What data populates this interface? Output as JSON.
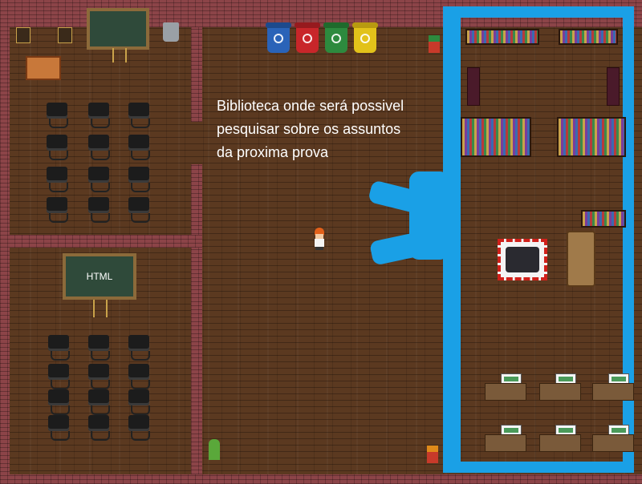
{
  "map": {
    "room_note": "Biblioteca onde será possivel pesquisar sobre os assuntos da proxima prova",
    "board_html_label": "HTML"
  },
  "colors": {
    "floor": "#5b3920",
    "wall": "#8c4448",
    "highlight": "#1aa0e6",
    "bin_blue": "#2a63b8",
    "bin_red": "#c8262a",
    "bin_green": "#2d8a3e",
    "bin_yellow": "#e2c21a"
  },
  "icons": [
    "recycle-bin-icon",
    "chair-icon",
    "bookshelf-icon",
    "computer-desk-icon",
    "cactus-icon",
    "player-character-icon",
    "easel-icon"
  ]
}
